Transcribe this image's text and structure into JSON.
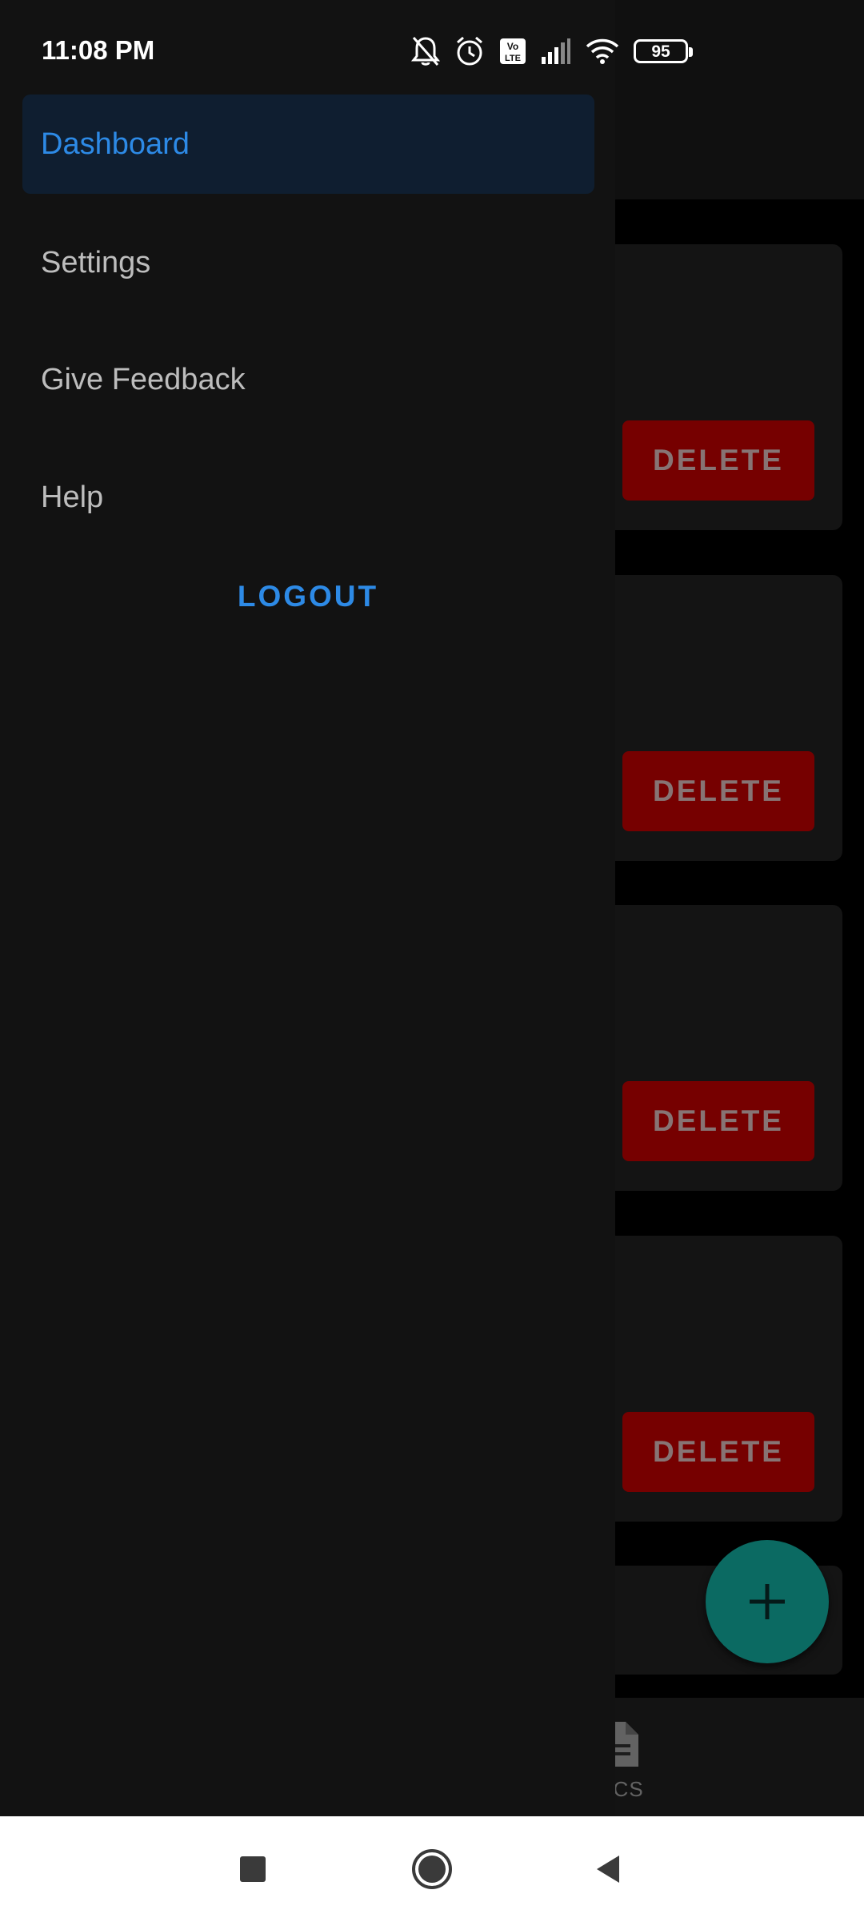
{
  "status_bar": {
    "time": "11:08 PM",
    "battery_level": "95",
    "icons": [
      "notifications-off-icon",
      "alarm-icon",
      "volte-icon",
      "signal-icon",
      "wifi-icon",
      "battery-icon"
    ]
  },
  "drawer": {
    "items": [
      {
        "label": "Dashboard",
        "active": true
      },
      {
        "label": "Settings",
        "active": false
      },
      {
        "label": "Give Feedback",
        "active": false
      },
      {
        "label": "Help",
        "active": false
      }
    ],
    "logout_label": "LOGOUT"
  },
  "background": {
    "cards": [
      {
        "delete_label": "DELETE"
      },
      {
        "delete_label": "DELETE"
      },
      {
        "delete_label": "DELETE"
      },
      {
        "delete_label": "DELETE"
      }
    ],
    "fab_icon": "plus-icon",
    "bottom_nav": {
      "partial_label": "OCS",
      "icon": "document-icon"
    }
  },
  "colors": {
    "accent": "#2d8ae6",
    "drawer_bg": "#121212",
    "delete_red": "#cc0000",
    "fab_teal": "#14b7aa"
  }
}
